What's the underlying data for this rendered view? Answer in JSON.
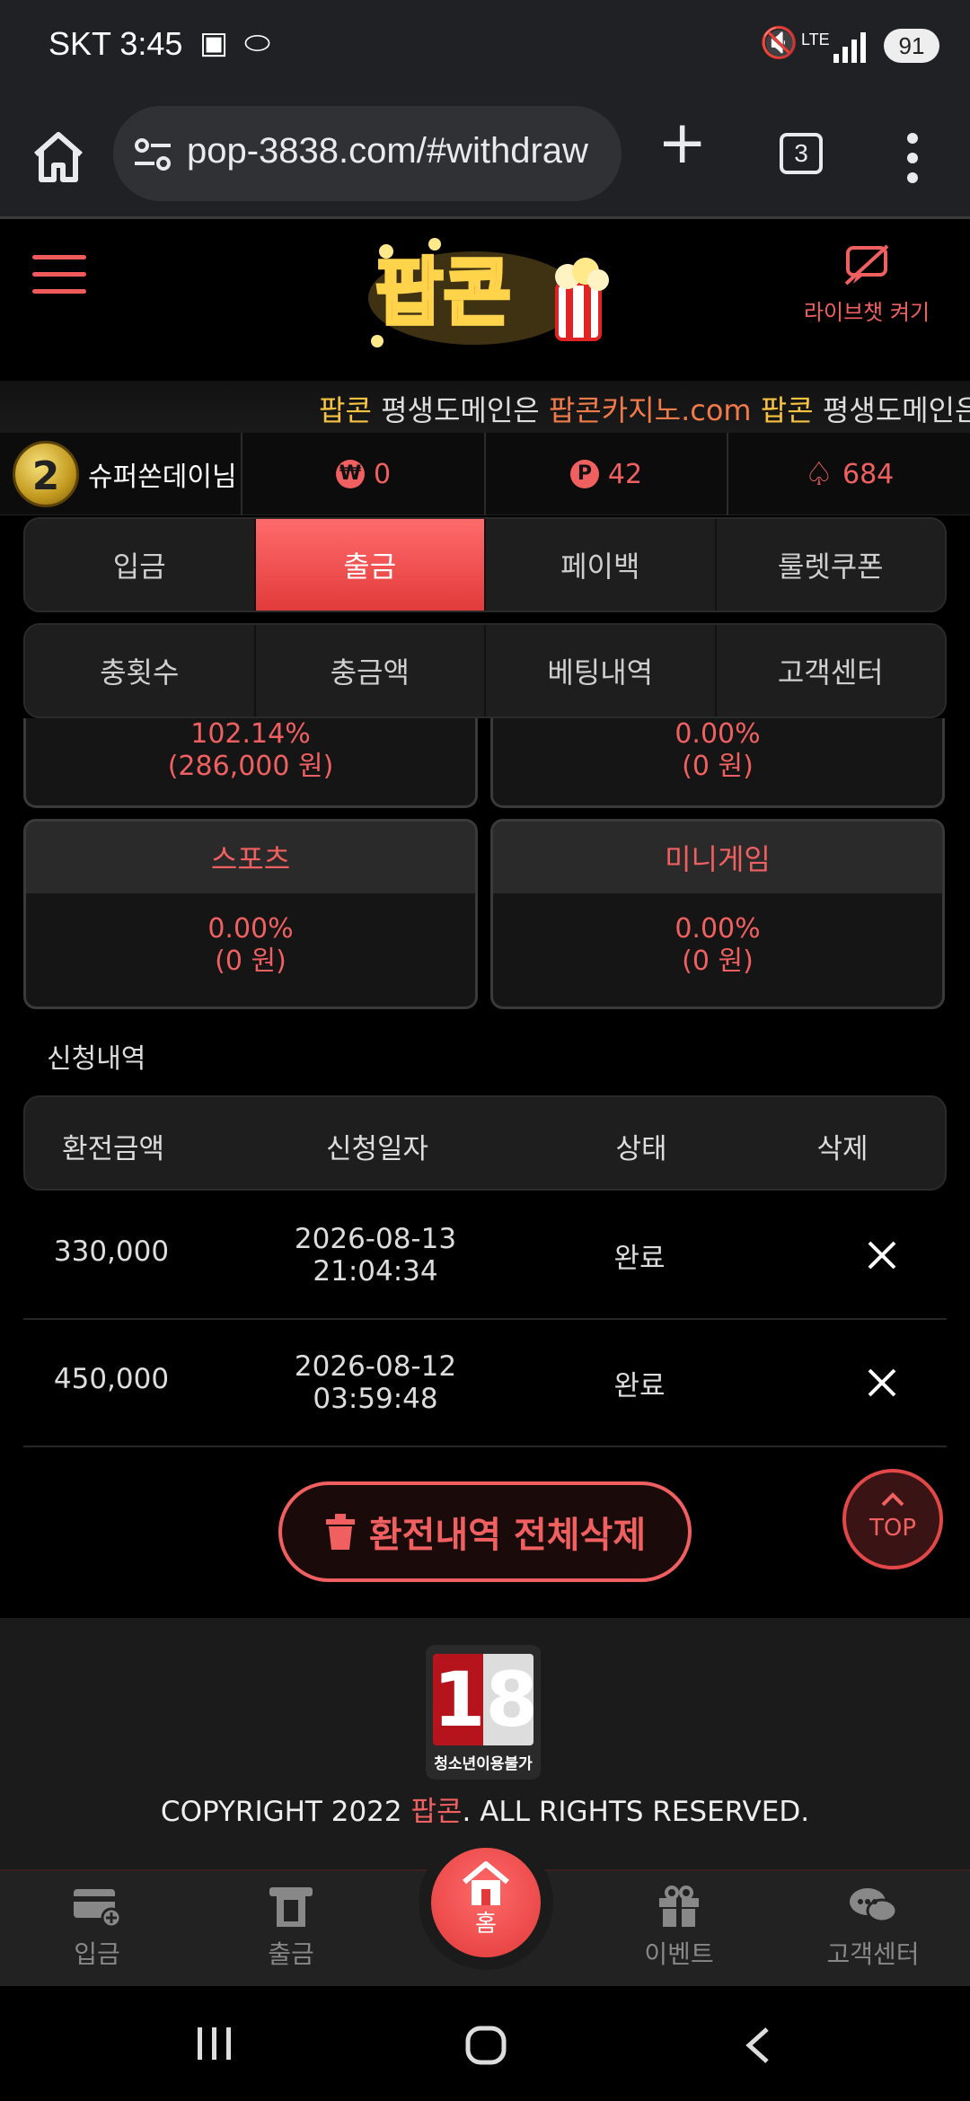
{
  "status": {
    "time": "SKT 3:45",
    "network": "LTE",
    "battery": "91"
  },
  "browser": {
    "url": "pop-3838.com/#withdraw",
    "tab_count": "3"
  },
  "header": {
    "live_chat_label": "라이브챗 켜기"
  },
  "marquee": {
    "brand": "팝콘",
    "text1": " 평생도메인은 ",
    "domain": "팝콘카지노.com",
    "brand2": " 팝콘",
    "text2": " 평생도메인은"
  },
  "user": {
    "level": "2",
    "name": "슈퍼쏜데이님",
    "won_symbol": "₩",
    "money": "0",
    "point_symbol": "P",
    "points": "42",
    "spade_value": "684"
  },
  "tabs_row1": [
    "입금",
    "출금",
    "페이백",
    "룰렛쿠폰"
  ],
  "tabs_row2": [
    "충횟수",
    "충금액",
    "베팅내역",
    "고객센터"
  ],
  "cards_partial": [
    {
      "percent": "102.14%",
      "amount": "(286,000 원)"
    },
    {
      "percent": "0.00%",
      "amount": "(0 원)"
    }
  ],
  "cards": [
    {
      "title": "스포츠",
      "percent": "0.00%",
      "amount": "(0 원)"
    },
    {
      "title": "미니게임",
      "percent": "0.00%",
      "amount": "(0 원)"
    }
  ],
  "history": {
    "title": "신청내역",
    "headers": [
      "환전금액",
      "신청일자",
      "상태",
      "삭제"
    ],
    "rows": [
      {
        "amount": "330,000",
        "date": "2026-08-13",
        "time": "21:04:34",
        "status": "완료"
      },
      {
        "amount": "450,000",
        "date": "2026-08-12",
        "time": "03:59:48",
        "status": "완료"
      }
    ]
  },
  "actions": {
    "delete_all": "환전내역 전체삭제",
    "top": "TOP"
  },
  "footer": {
    "age_label": "청소년이용불가",
    "age_number": "18",
    "copy_pre": "COPYRIGHT 2022 ",
    "copy_brand": "팝콘",
    "copy_post": ". ALL RIGHTS RESERVED."
  },
  "bottom_nav": {
    "deposit": "입금",
    "withdraw": "출금",
    "home": "홈",
    "event": "이벤트",
    "support": "고객센터"
  },
  "logo_text": "팝콘",
  "colors": {
    "accent": "#f06060",
    "active_tab": "#ff5a5a",
    "gold": "#f5c242"
  }
}
